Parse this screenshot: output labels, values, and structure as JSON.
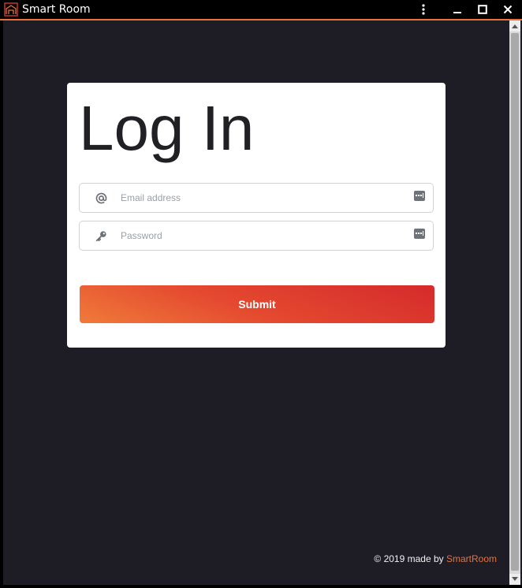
{
  "window": {
    "title": "Smart Room",
    "icon": "app-logo-icon",
    "controls": [
      "kebab-menu-icon",
      "minimize-icon",
      "maximize-icon",
      "close-icon"
    ],
    "accent_color": "#e8713c"
  },
  "login": {
    "heading": "Log In",
    "email": {
      "placeholder": "Email address",
      "value": "",
      "icon": "at-icon"
    },
    "password": {
      "placeholder": "Password",
      "value": "",
      "icon": "key-icon"
    },
    "submit_label": "Submit"
  },
  "footer": {
    "prefix": "© 2019 made by ",
    "brand": "SmartRoom"
  },
  "colors": {
    "background": "#1e1d26",
    "card": "#ffffff",
    "button_gradient": [
      "#f07b3a",
      "#d52a2c"
    ]
  }
}
